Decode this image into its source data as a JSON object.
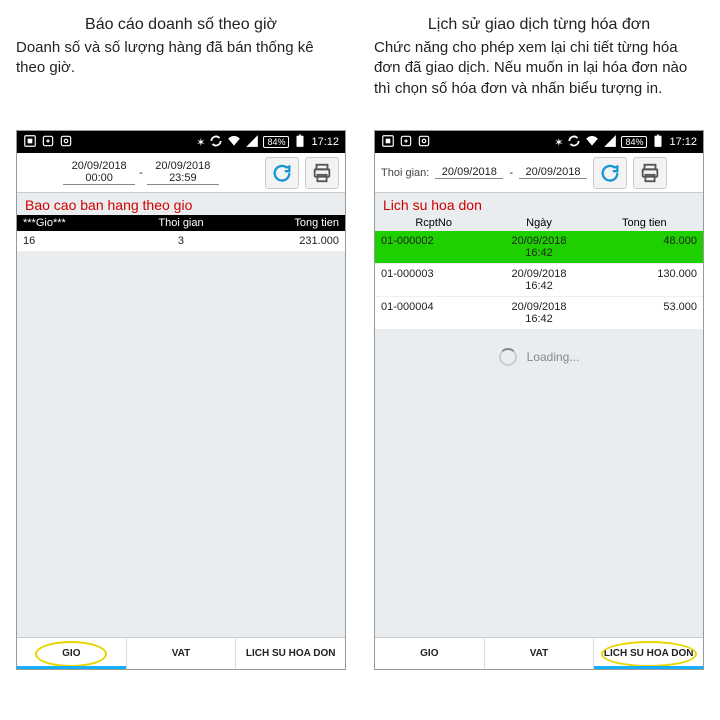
{
  "left": {
    "title": "Báo cáo doanh số theo giờ",
    "desc": "Doanh số và số lượng hàng đã bán thống kê theo giờ.",
    "status": {
      "battery": "84%",
      "clock": "17:12"
    },
    "range": {
      "from_date": "20/09/2018",
      "from_time": "00:00",
      "to_date": "20/09/2018",
      "to_time": "23:59",
      "dash": "-"
    },
    "section": "Bao cao ban hang theo gio",
    "cols": {
      "c1": "***Gio***",
      "c2": "Thoi gian",
      "c3": "Tong tien"
    },
    "rows": [
      {
        "c1": "16",
        "c2": "3",
        "c3": "231.000"
      }
    ],
    "tabs": {
      "t1": "GIO",
      "t2": "VAT",
      "t3": "LICH SU HOA DON"
    }
  },
  "right": {
    "title": "Lịch sử giao dịch từng hóa đơn",
    "desc": "Chức năng cho phép xem lại chi tiết từng hóa đơn đã giao dịch. Nếu muốn in lại hóa đơn nào thì chọn số hóa đơn và nhấn biểu tượng in.",
    "status": {
      "battery": "84%",
      "clock": "17:12"
    },
    "range": {
      "label": "Thoi gian:",
      "from_date": "20/09/2018",
      "to_date": "20/09/2018",
      "dash": "-"
    },
    "section": "Lich su hoa don",
    "cols": {
      "c1": "RcptNo",
      "c2": "Ngày",
      "c3": "Tong tien"
    },
    "rows": [
      {
        "c1": "01-000002",
        "c2a": "20/09/2018",
        "c2b": "16:42",
        "c3": "48.000",
        "hl": true
      },
      {
        "c1": "01-000003",
        "c2a": "20/09/2018",
        "c2b": "16:42",
        "c3": "130.000",
        "hl": false
      },
      {
        "c1": "01-000004",
        "c2a": "20/09/2018",
        "c2b": "16:42",
        "c3": "53.000",
        "hl": false
      }
    ],
    "loading": "Loading...",
    "tabs": {
      "t1": "GIO",
      "t2": "VAT",
      "t3": "LICH SU HOA DON"
    }
  }
}
